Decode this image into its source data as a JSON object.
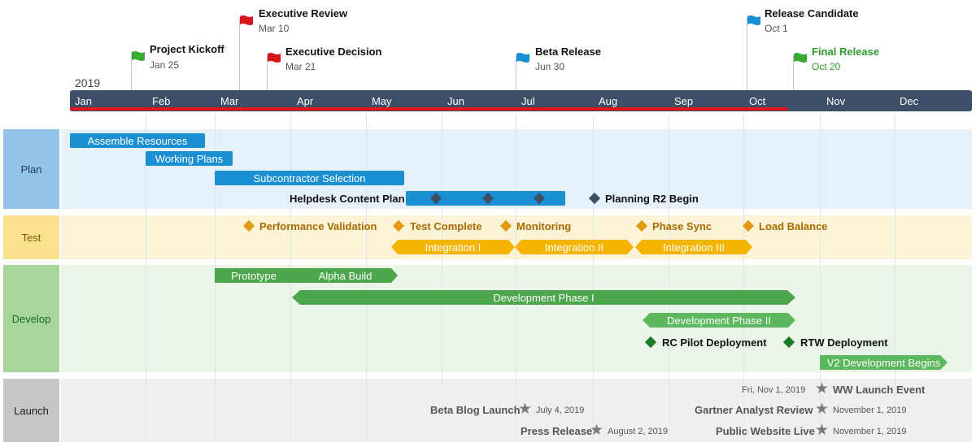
{
  "year": "2019",
  "months": [
    "Jan",
    "Feb",
    "Mar",
    "Apr",
    "May",
    "Jun",
    "Jul",
    "Aug",
    "Sep",
    "Oct",
    "Nov",
    "Dec"
  ],
  "milestones": [
    {
      "title": "Project Kickoff",
      "date": "Jan 25",
      "color": "#3aaa35"
    },
    {
      "title": "Executive Review",
      "date": "Mar 10",
      "color": "#d7141a"
    },
    {
      "title": "Executive Decision",
      "date": "Mar 21",
      "color": "#d7141a"
    },
    {
      "title": "Beta Release",
      "date": "Jun 30",
      "color": "#1a8fd1"
    },
    {
      "title": "Release Candidate",
      "date": "Oct 1",
      "color": "#1a8fd1"
    },
    {
      "title": "Final Release",
      "date": "Oct 20",
      "color": "#3aaa35",
      "title_color": "#2e9a2e"
    }
  ],
  "lanes": {
    "plan": {
      "label": "Plan",
      "bg": "#e6f0fa",
      "label_bg": "#93c3e8",
      "label_color": "#1f3c5a"
    },
    "test": {
      "label": "Test",
      "bg": "#fdf4d8",
      "label_bg": "#fde18e",
      "label_color": "#7a5b00"
    },
    "develop": {
      "label": "Develop",
      "bg": "#eaf5e7",
      "label_bg": "#a6d69a",
      "label_color": "#1d6b1d"
    },
    "launch": {
      "label": "Launch",
      "bg": "#efefef",
      "label_bg": "#c6c6c6",
      "label_color": "#222"
    }
  },
  "plan": {
    "tasks": [
      "Assemble Resources",
      "Working Plans",
      "Subcontractor Selection"
    ],
    "helpdesk_label": "Helpdesk Content Plan",
    "planning_r2": "Planning R2 Begin"
  },
  "test": {
    "milestones": [
      "Performance Validation",
      "Test Complete",
      "Monitoring",
      "Phase Sync",
      "Load Balance"
    ],
    "integrations": [
      "Integration I",
      "Integration II",
      "Integration III"
    ]
  },
  "develop": {
    "prototype": "Prototype",
    "alpha": "Alpha Build",
    "phase1": "Development Phase I",
    "phase2": "Development Phase II",
    "rc_pilot": "RC Pilot Deployment",
    "rtw": "RTW Deployment",
    "v2": "V2 Development Begins"
  },
  "launch": {
    "ww_date": "Fri, Nov 1, 2019",
    "ww_label": "WW Launch Event",
    "beta_blog": "Beta Blog Launch",
    "beta_blog_date": "July 4, 2019",
    "gartner": "Gartner Analyst Review",
    "gartner_date": "November 1, 2019",
    "press": "Press Release",
    "press_date": "August 2, 2019",
    "website": "Public Website Live",
    "website_date": "November 1, 2019"
  }
}
